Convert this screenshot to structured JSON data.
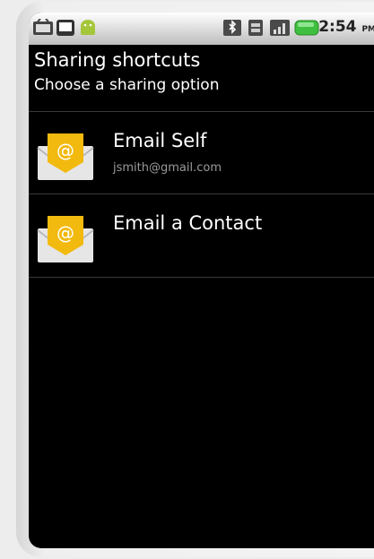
{
  "status_bar": {
    "time": "2:54",
    "ampm": "PM",
    "icons": [
      "android-debug-icon",
      "sd-card-icon",
      "android-robot-icon",
      "bluetooth-icon",
      "sim-card-icon",
      "signal-icon",
      "battery-icon"
    ],
    "colors": {
      "bar_top": "#ffffff",
      "bar_bottom": "#bdbdbd",
      "battery_green": "#3fbf3f",
      "android_green": "#a4c639"
    }
  },
  "header": {
    "title": "Sharing shortcuts",
    "subtitle": "Choose a sharing option"
  },
  "options": [
    {
      "label": "Email Self",
      "sublabel": "jsmith@gmail.com",
      "icon": "email-envelope-icon"
    },
    {
      "label": "Email a Contact",
      "icon": "email-envelope-icon"
    }
  ],
  "colors": {
    "background": "#000000",
    "text": "#ffffff",
    "secondary_text": "#9a9a9a",
    "envelope_yellow": "#f2b90f"
  }
}
